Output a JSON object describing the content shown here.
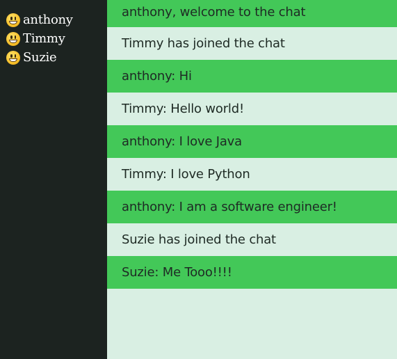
{
  "sidebar": {
    "users": [
      {
        "name": "anthony",
        "icon": "grinning-face-icon"
      },
      {
        "name": "Timmy",
        "icon": "grinning-face-icon"
      },
      {
        "name": "Suzie",
        "icon": "grinning-face-icon"
      }
    ]
  },
  "chat": {
    "messages": [
      {
        "text": "anthony, welcome to the chat",
        "style": "green"
      },
      {
        "text": "Timmy has joined the chat",
        "style": "light"
      },
      {
        "text": "anthony: Hi",
        "style": "green"
      },
      {
        "text": "Timmy: Hello world!",
        "style": "light"
      },
      {
        "text": "anthony: I love Java",
        "style": "green"
      },
      {
        "text": "Timmy: I love Python",
        "style": "light"
      },
      {
        "text": "anthony: I am a software engineer!",
        "style": "green"
      },
      {
        "text": "Suzie has joined the chat",
        "style": "light"
      },
      {
        "text": "Suzie: Me Tooo!!!!",
        "style": "green"
      }
    ]
  },
  "colors": {
    "sidebar_bg": "#1c2320",
    "chat_bg": "#d9efe3",
    "message_green": "#43c858",
    "text": "#1e2a24"
  }
}
